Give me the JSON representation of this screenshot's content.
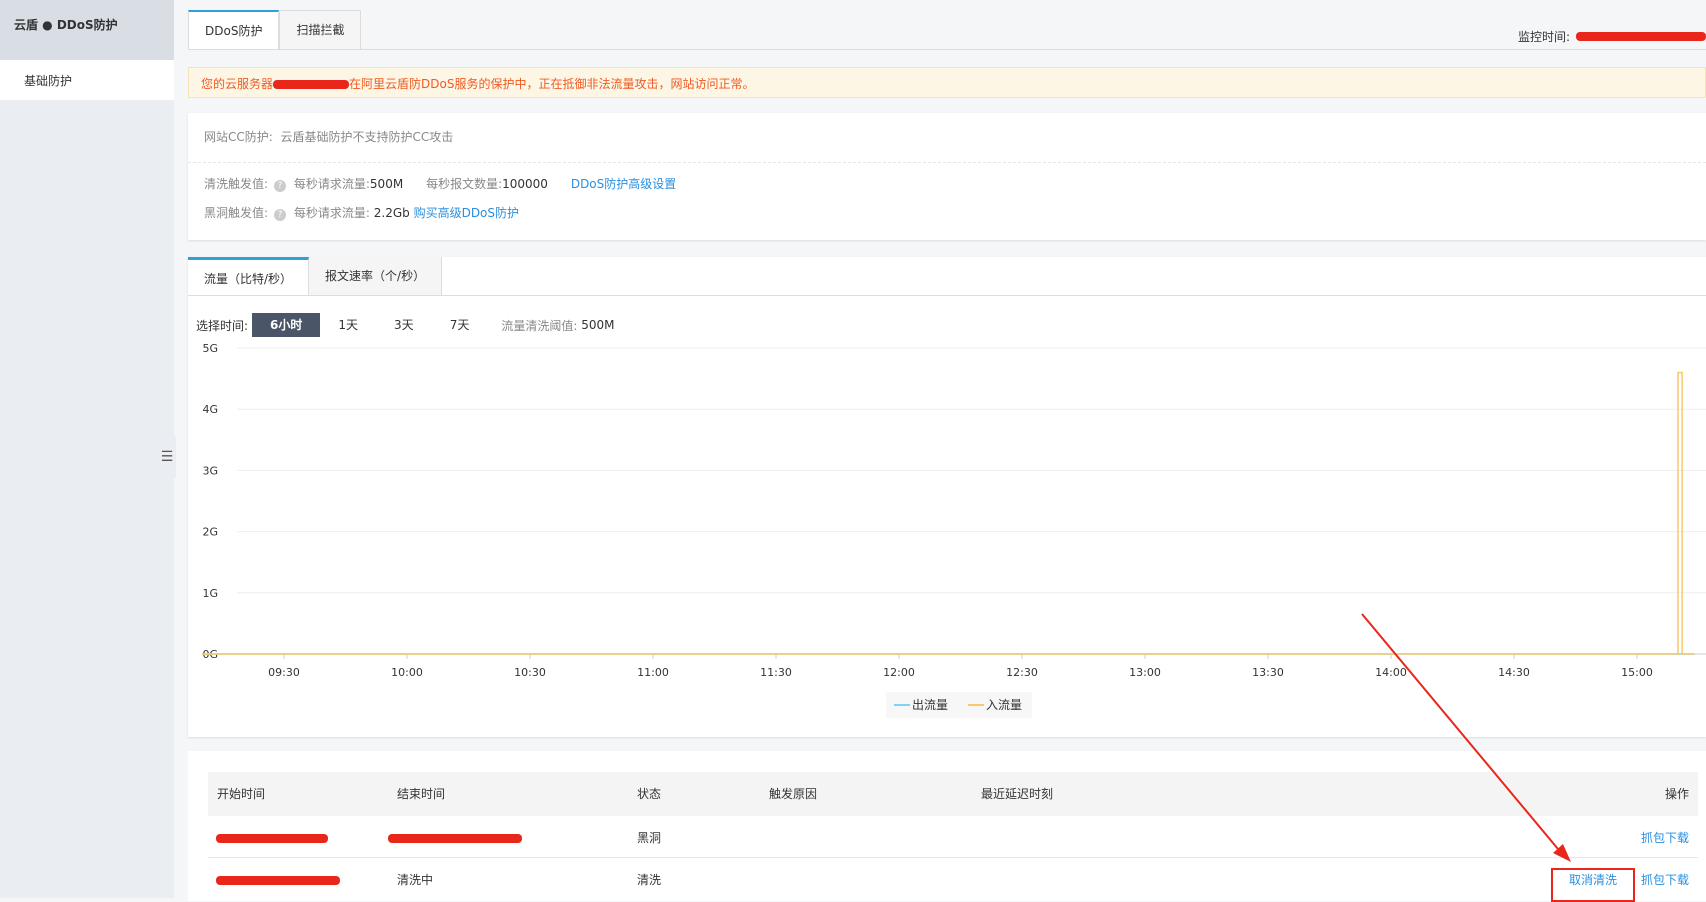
{
  "sidebar": {
    "title": "云盾 ● DDoS防护",
    "items": [
      {
        "label": "基础防护"
      }
    ]
  },
  "tabs": [
    {
      "label": "DDoS防护",
      "active": true
    },
    {
      "label": "扫描拦截",
      "active": false
    }
  ],
  "monitor_label": "监控时间:",
  "alert": {
    "prefix": "您的云服务器",
    "suffix": "在阿里云盾防DDoS服务的保护中，正在抵御非法流量攻击，网站访问正常。"
  },
  "info": {
    "cc_label": "网站CC防护:",
    "cc_value": "云盾基础防护不支持防护CC攻击",
    "clean_label": "清洗触发值:",
    "clean_bps_label": "每秒请求流量:",
    "clean_bps": "500M",
    "clean_pps_label": "每秒报文数量:",
    "clean_pps": "100000",
    "advanced_link": "DDoS防护高级设置",
    "blackhole_label": "黑洞触发值:",
    "blackhole_bps_label": "每秒请求流量:",
    "blackhole_bps": "2.2Gb",
    "buy_link": "购买高级DDoS防护"
  },
  "chart_tabs": [
    {
      "label": "流量（比特/秒）"
    },
    {
      "label": "报文速率（个/秒）"
    }
  ],
  "time": {
    "label": "选择时间:",
    "options": [
      "6小时",
      "1天",
      "3天",
      "7天"
    ],
    "selected": "6小时",
    "threshold_label": "流量清洗阈值:",
    "threshold": "500M"
  },
  "chart_data": {
    "type": "line",
    "y_ticks": [
      "0G",
      "1G",
      "2G",
      "3G",
      "4G",
      "5G"
    ],
    "ylim": [
      0,
      5
    ],
    "x_ticks": [
      "09:30",
      "10:00",
      "10:30",
      "11:00",
      "11:30",
      "12:00",
      "12:30",
      "13:00",
      "13:30",
      "14:00",
      "14:30",
      "15:00"
    ],
    "grid": true,
    "legend": "bottom",
    "series": [
      {
        "name": "出流量",
        "color": "#7dd3f5",
        "points": [
          [
            "09:10",
            0
          ],
          [
            "15:14",
            0
          ]
        ]
      },
      {
        "name": "入流量",
        "color": "#f7c96b",
        "points": [
          [
            "09:10",
            0
          ],
          [
            "15:10",
            0
          ],
          [
            "15:10",
            4.6
          ],
          [
            "15:11",
            4.6
          ],
          [
            "15:11",
            0
          ],
          [
            "15:14",
            0
          ]
        ]
      }
    ]
  },
  "table": {
    "headers": [
      "开始时间",
      "结束时间",
      "状态",
      "触发原因",
      "最近延迟时刻",
      "操作"
    ],
    "rows": [
      {
        "end": "",
        "status": "黑洞",
        "actions": [
          "抓包下载"
        ]
      },
      {
        "end": "清洗中",
        "status": "清洗",
        "actions": [
          "取消清洗",
          "抓包下载"
        ]
      }
    ]
  },
  "colors": {
    "accent": "#2ea0d8",
    "link": "#2a8fe0",
    "alert_text": "#f05a22",
    "annotation": "#e8271a"
  }
}
